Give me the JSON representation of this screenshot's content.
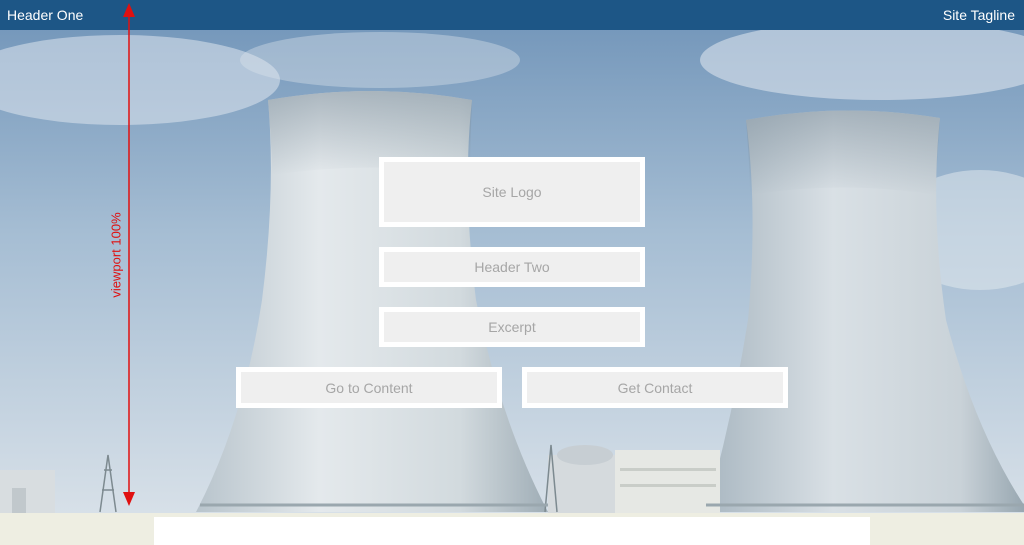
{
  "header": {
    "title": "Header One",
    "tagline": "Site Tagline"
  },
  "hero": {
    "logo_placeholder": "Site Logo",
    "subtitle_placeholder": "Header Two",
    "excerpt_placeholder": "Excerpt",
    "primary_button": "Go to Content",
    "secondary_button": "Get Contact"
  },
  "annotation": {
    "viewport_label": "viewport 100%"
  },
  "colors": {
    "header_bar": "#1d5686",
    "annotation": "#e01010",
    "placeholder_fill": "#efefef",
    "page_background": "#eeeee2"
  },
  "icons": {
    "viewport_arrow": "double-headed-vertical-arrow"
  }
}
